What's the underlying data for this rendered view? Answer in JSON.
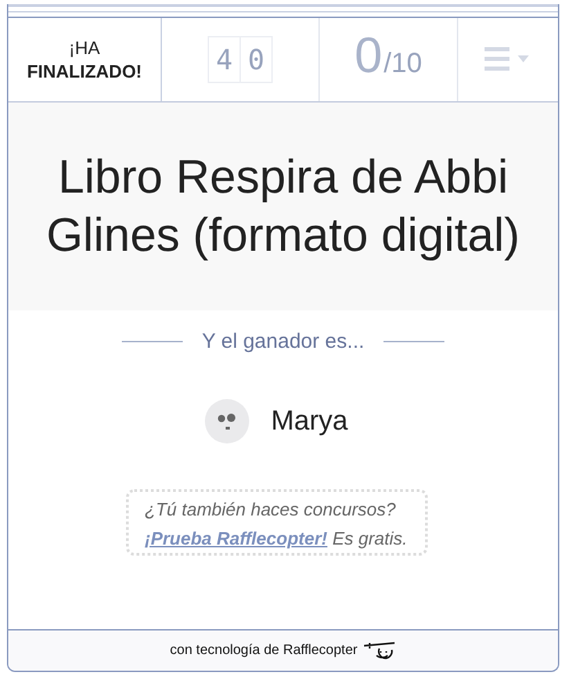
{
  "header": {
    "status_top": "¡HA",
    "status_bottom": "FINALIZADO!",
    "entry_digits": [
      "4",
      "0"
    ],
    "entries_done": "0",
    "entries_total": "/10"
  },
  "prize": {
    "title": "Libro Respira de Abbi Glines (formato digital)"
  },
  "winner": {
    "heading": "Y el ganador es...",
    "name": "Marya"
  },
  "promo": {
    "text": "¿Tú también haces concursos?",
    "link": "¡Prueba Rafflecopter!",
    "after": "Es gratis."
  },
  "footer": {
    "text": "con tecnología de Rafflecopter"
  }
}
